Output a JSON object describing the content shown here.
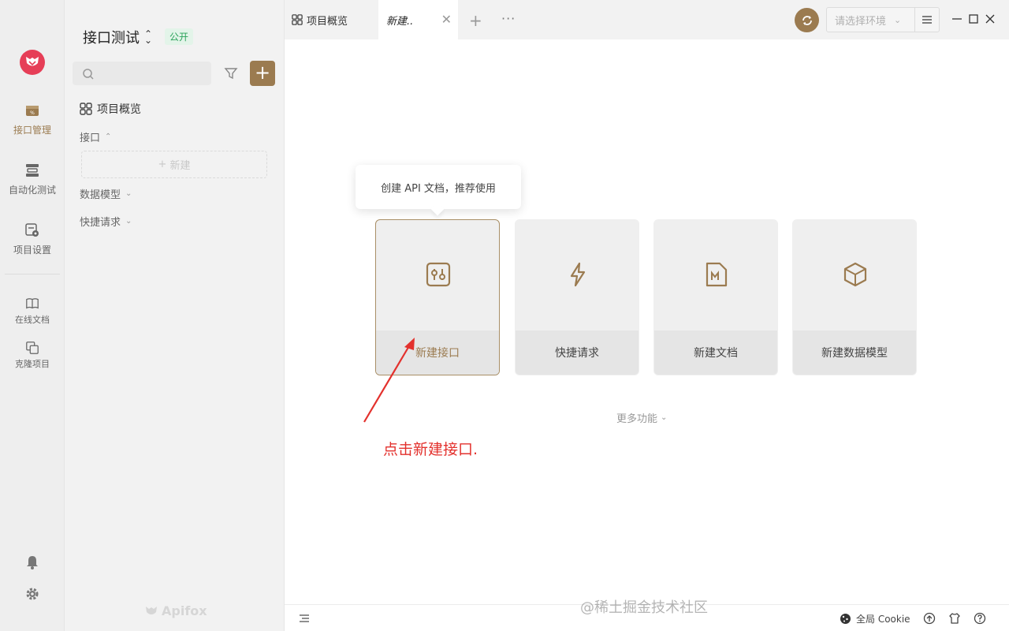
{
  "rail": {
    "items": [
      {
        "label": "接口管理",
        "icon": "api-management-icon"
      },
      {
        "label": "自动化测试",
        "icon": "automation-test-icon"
      },
      {
        "label": "项目设置",
        "icon": "project-settings-icon"
      },
      {
        "label": "在线文档",
        "icon": "book-icon"
      },
      {
        "label": "克隆项目",
        "icon": "clone-icon"
      }
    ]
  },
  "sidebar": {
    "project_title": "接口测试",
    "visibility_badge": "公开",
    "search_placeholder": "",
    "overview_label": "项目概览",
    "tree": {
      "api_label": "接口",
      "new_label": "新建",
      "models_label": "数据模型",
      "quick_label": "快捷请求"
    },
    "brand": "Apifox"
  },
  "tabs": {
    "overview_label": "项目概览",
    "active_label": "新建..",
    "env_placeholder": "请选择环境"
  },
  "main": {
    "tooltip": "创建 API 文档，推荐使用",
    "cards": [
      {
        "label": "新建接口",
        "icon": "api-icon"
      },
      {
        "label": "快捷请求",
        "icon": "lightning-icon"
      },
      {
        "label": "新建文档",
        "icon": "markdown-doc-icon"
      },
      {
        "label": "新建数据模型",
        "icon": "cube-icon"
      }
    ],
    "more_label": "更多功能",
    "annotation": "点击新建接口."
  },
  "status": {
    "cookie_label": "全局 Cookie"
  },
  "watermark": "@稀土掘金技术社区",
  "colors": {
    "accent": "#9b7b50",
    "logo": "#e63e57",
    "badge_green": "#2ca35b",
    "annotation_red": "#e3312d"
  }
}
